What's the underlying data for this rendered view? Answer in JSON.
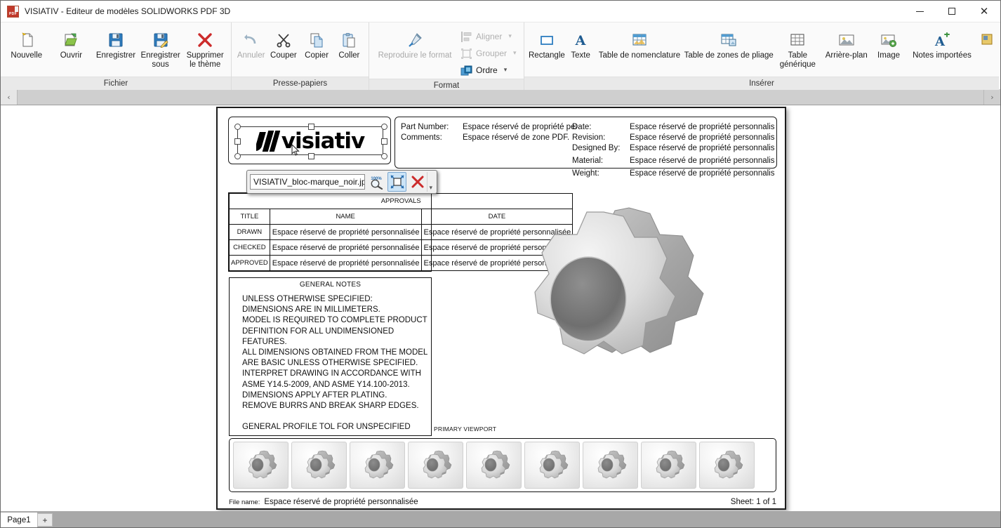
{
  "window": {
    "title": "VISIATIV - Editeur de modèles SOLIDWORKS PDF 3D",
    "app_icon": "solidworks-pdf-icon",
    "minimize": "—",
    "maximize": "☐",
    "close": "✕"
  },
  "ribbon": {
    "groups": [
      {
        "title": "Fichier",
        "buttons": [
          {
            "label": "Nouvelle",
            "icon": "new-document-icon",
            "disabled": false
          },
          {
            "label": "Ouvrir",
            "icon": "open-folder-icon",
            "disabled": false
          },
          {
            "label": "Enregistrer",
            "icon": "save-floppy-icon",
            "disabled": false
          },
          {
            "label": "Enregistrer sous",
            "icon": "save-as-floppy-icon",
            "disabled": false
          },
          {
            "label": "Supprimer le thème",
            "icon": "delete-cross-icon",
            "disabled": false
          }
        ]
      },
      {
        "title": "Presse-papiers",
        "buttons": [
          {
            "label": "Annuler",
            "icon": "undo-arrow-icon",
            "disabled": true
          },
          {
            "label": "Couper",
            "icon": "scissors-icon",
            "disabled": false
          },
          {
            "label": "Copier",
            "icon": "copy-icon",
            "disabled": false
          },
          {
            "label": "Coller",
            "icon": "paste-clipboard-icon",
            "disabled": false
          }
        ]
      },
      {
        "title": "Format",
        "buttons": [
          {
            "label": "Reproduire le format",
            "icon": "format-painter-icon",
            "disabled": true
          }
        ],
        "small_buttons": [
          {
            "label": "Aligner",
            "icon": "align-icon",
            "disabled": true,
            "has_caret": true
          },
          {
            "label": "Grouper",
            "icon": "group-icon",
            "disabled": true,
            "has_caret": true
          },
          {
            "label": "Ordre",
            "icon": "order-layers-icon",
            "disabled": false,
            "has_caret": true
          }
        ]
      },
      {
        "title": "Insérer",
        "buttons": [
          {
            "label": "Rectangle",
            "icon": "rectangle-icon",
            "disabled": false
          },
          {
            "label": "Texte",
            "icon": "text-a-icon",
            "disabled": false
          },
          {
            "label": "Table de nomenclature",
            "icon": "bom-table-icon",
            "disabled": false
          },
          {
            "label": "Table de zones de pliage",
            "icon": "bend-table-icon",
            "disabled": false
          },
          {
            "label": "Table générique",
            "icon": "generic-table-icon",
            "disabled": false
          },
          {
            "label": "Arrière-plan",
            "icon": "background-image-icon",
            "disabled": false
          },
          {
            "label": "Image",
            "icon": "insert-image-icon",
            "disabled": false
          },
          {
            "label": "Notes importées",
            "icon": "imported-notes-icon",
            "disabled": false
          }
        ]
      }
    ],
    "scroll_left": "‹",
    "scroll_right": "›"
  },
  "image_toolbar": {
    "file_name": "VISIATIV_bloc-marque_noir.jpg",
    "zoom_100_icon": "zoom-100-percent-icon",
    "fit_icon": "fit-to-frame-icon",
    "remove_icon": "remove-red-x-icon",
    "grip": "▾"
  },
  "document": {
    "logo_text": "visiativ",
    "header_left": [
      {
        "key": "Part Number:",
        "value": "Espace réservé de propriété personnalisée"
      },
      {
        "key": "Comments:",
        "value": "Espace réservé de zone PDF."
      }
    ],
    "header_right": [
      {
        "key": "Date:",
        "value": "Espace réservé de propriété personnalisée"
      },
      {
        "key": "Revision:",
        "value": "Espace réservé de propriété personnalisée"
      },
      {
        "key": "Designed By:",
        "value": "Espace réservé de propriété personnalisée"
      },
      {
        "key": "Material:",
        "value": "Espace réservé de propriété personnalisée"
      },
      {
        "key": "Weight:",
        "value": "Espace réservé de propriété personnalisée"
      }
    ],
    "approvals": {
      "caption": "APPROVALS",
      "columns": [
        "TITLE",
        "NAME",
        "DATE"
      ],
      "rows": [
        [
          "DRAWN",
          "Espace réservé de propriété personnalisée",
          "Espace réservé de propriété personnalisée"
        ],
        [
          "CHECKED",
          "Espace réservé de propriété personnalisée",
          "Espace réservé de propriété personnalisée"
        ],
        [
          "APPROVED",
          "Espace réservé de propriété personnalisée",
          "Espace réservé de propriété personnalisée"
        ]
      ]
    },
    "general_notes": {
      "title": "GENERAL NOTES",
      "lines": [
        "UNLESS OTHERWISE SPECIFIED:",
        "DIMENSIONS ARE IN MILLIMETERS.",
        "MODEL IS REQUIRED TO COMPLETE PRODUCT",
        "DEFINITION FOR ALL UNDIMENSIONED",
        "FEATURES.",
        "ALL DIMENSIONS OBTAINED FROM THE MODEL",
        "ARE BASIC UNLESS OTHERWISE SPECIFIED.",
        "INTERPRET DRAWING IN ACCORDANCE WITH",
        "ASME Y14.5-2009, AND ASME Y14.100-2013.",
        "DIMENSIONS APPLY AFTER PLATING.",
        "REMOVE BURRS AND BREAK SHARP EDGES.",
        "",
        "GENERAL PROFILE TOL FOR UNSPECIFIED"
      ]
    },
    "viewport_label": "PRIMARY VIEWPORT",
    "model_icon": "gear-3d-model",
    "thumbnail_count": 9,
    "footer": {
      "file_name_label": "File name:",
      "file_name_value": "Espace réservé de propriété personnalisée",
      "sheet": "Sheet: 1 of 1"
    }
  },
  "statusbar": {
    "page_tab": "Page1",
    "add_tab": "+"
  },
  "colors": {
    "accent_blue": "#2e7dc0",
    "red": "#c0392b",
    "ribbon_bg": "#fafafa",
    "group_title_bg": "#e9e9e9",
    "statusbar_bg": "#a8a8a8"
  }
}
